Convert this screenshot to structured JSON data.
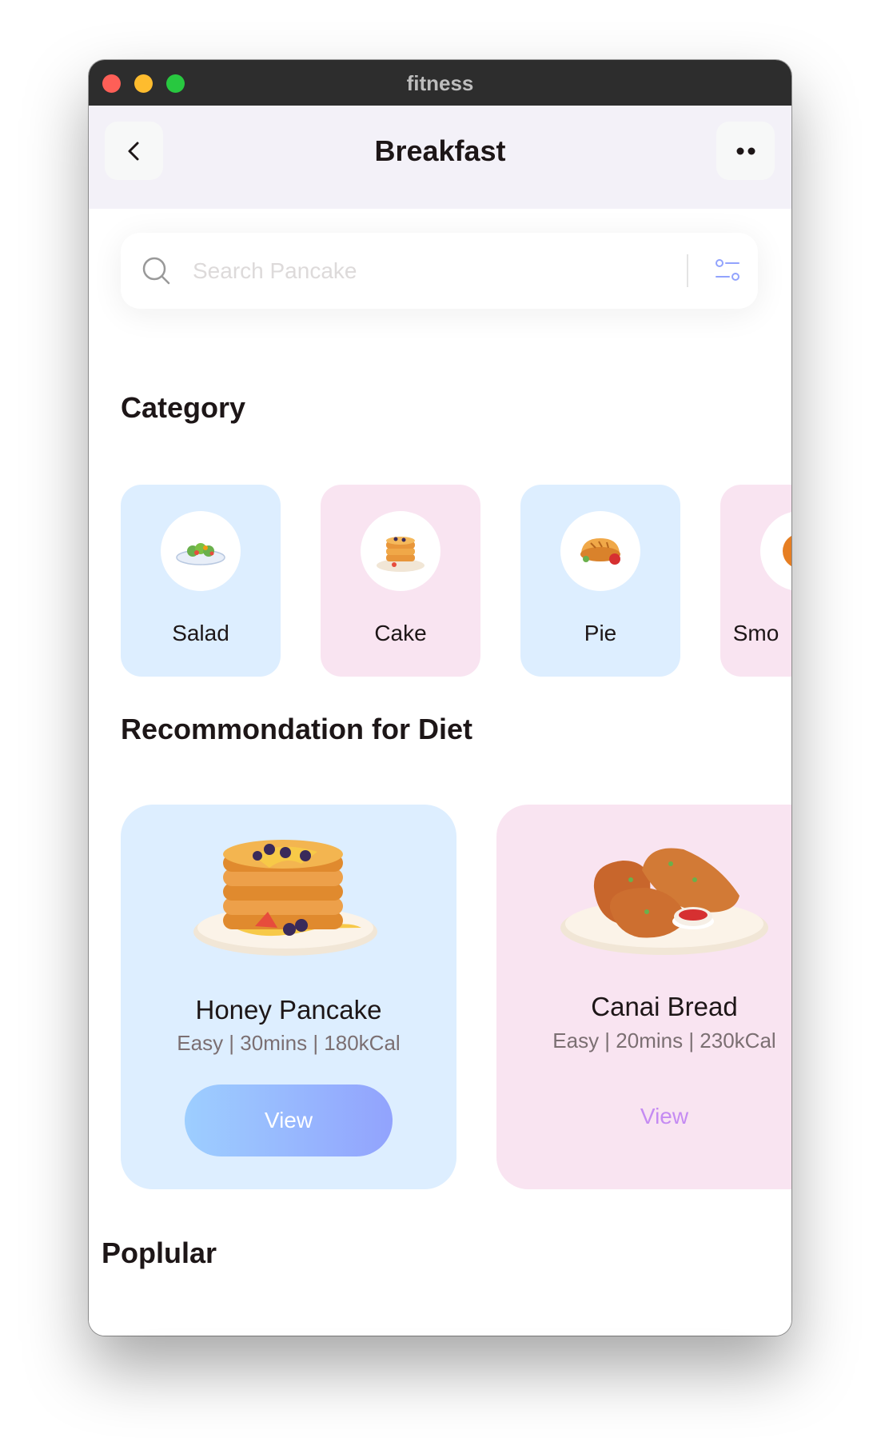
{
  "window": {
    "title": "fitness"
  },
  "header": {
    "title": "Breakfast"
  },
  "search": {
    "placeholder": "Search Pancake"
  },
  "category": {
    "title": "Category",
    "items": [
      {
        "label": "Salad",
        "bg": "#ddeeff"
      },
      {
        "label": "Cake",
        "bg": "#f9e4f1"
      },
      {
        "label": "Pie",
        "bg": "#ddeeff"
      },
      {
        "label": "Smo",
        "bg": "#f9e4f1"
      }
    ]
  },
  "recommendation": {
    "title": "Recommondation for Diet",
    "items": [
      {
        "name": "Honey Pancake",
        "meta": "Easy | 30mins | 180kCal",
        "button": "View",
        "bg": "#ddeeff"
      },
      {
        "name": "Canai Bread",
        "meta": "Easy | 20mins | 230kCal",
        "button": "View",
        "bg": "#f9e4f1"
      }
    ]
  },
  "popular": {
    "title": "Poplular"
  },
  "colors": {
    "accent_gradient_start": "#9dceff",
    "accent_gradient_end": "#92a3fd",
    "secondary_purple": "#c58bf2"
  }
}
